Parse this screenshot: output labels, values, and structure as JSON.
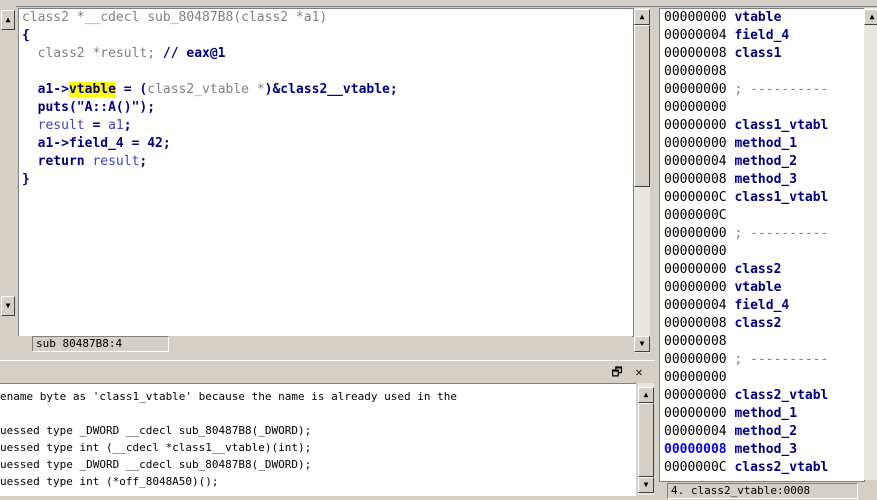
{
  "code_view": {
    "signature": "class2 *__cdecl sub_80487B8(class2 *a1)",
    "open_brace": "{",
    "decl_type": "class2 *result; ",
    "decl_comment": "// eax@1",
    "l1_a": "a1->",
    "l1_field": "vtable",
    "l1_b": " = (",
    "l1_cast": "class2_vtable *",
    "l1_c": ")&class2__vtable;",
    "l2": "puts(\"A::A()\");",
    "l3_a": "result",
    "l3_b": " = ",
    "l3_c": "a1",
    "l3_d": ";",
    "l4": "a1->field_4 = 42;",
    "l5_a": "return ",
    "l5_b": "result",
    "l5_c": ";",
    "close_brace": "}"
  },
  "code_status": "sub 80487B8:4",
  "output_window": {
    "lines": [
      "ename byte as 'class1_vtable' because the name is already used in the",
      "",
      "uessed type _DWORD __cdecl sub_80487B8(_DWORD);",
      "uessed type int (__cdecl *class1__vtable)(int);",
      "uessed type _DWORD __cdecl sub_80487B8(_DWORD);",
      "uessed type int (*off_8048A50)();"
    ],
    "dock_icon": "🗗",
    "close_icon": "✕"
  },
  "structures": {
    "rows": [
      {
        "addr": "00000000",
        "name": "vtable",
        "kind": "member"
      },
      {
        "addr": "00000004",
        "name": "field_4",
        "kind": "member"
      },
      {
        "addr": "00000008",
        "name": "class1",
        "kind": "member"
      },
      {
        "addr": "00000008",
        "name": "",
        "kind": "blank"
      },
      {
        "addr": "00000000",
        "name": "; ----------",
        "kind": "sep"
      },
      {
        "addr": "00000000",
        "name": "",
        "kind": "blank"
      },
      {
        "addr": "00000000",
        "name": "class1_vtabl",
        "kind": "member"
      },
      {
        "addr": "00000000",
        "name": "method_1",
        "kind": "member"
      },
      {
        "addr": "00000004",
        "name": "method_2",
        "kind": "member"
      },
      {
        "addr": "00000008",
        "name": "method_3",
        "kind": "member"
      },
      {
        "addr": "0000000C",
        "name": "class1_vtabl",
        "kind": "member"
      },
      {
        "addr": "0000000C",
        "name": "",
        "kind": "blank"
      },
      {
        "addr": "00000000",
        "name": "; ----------",
        "kind": "sep"
      },
      {
        "addr": "00000000",
        "name": "",
        "kind": "blank"
      },
      {
        "addr": "00000000",
        "name": "class2",
        "kind": "member"
      },
      {
        "addr": "00000000",
        "name": "vtable",
        "kind": "member"
      },
      {
        "addr": "00000004",
        "name": "field_4",
        "kind": "member"
      },
      {
        "addr": "00000008",
        "name": "class2",
        "kind": "member"
      },
      {
        "addr": "00000008",
        "name": "",
        "kind": "blank"
      },
      {
        "addr": "00000000",
        "name": "; ----------",
        "kind": "sep"
      },
      {
        "addr": "00000000",
        "name": "",
        "kind": "blank"
      },
      {
        "addr": "00000000",
        "name": "class2_vtabl",
        "kind": "member"
      },
      {
        "addr": "00000000",
        "name": "method_1",
        "kind": "member"
      },
      {
        "addr": "00000004",
        "name": "method_2",
        "kind": "member"
      },
      {
        "addr": "00000008",
        "name": "method_3",
        "kind": "selected"
      },
      {
        "addr": "0000000C",
        "name": "class2_vtabl",
        "kind": "member"
      }
    ],
    "status": "4. class2_vtable:0008"
  },
  "colors": {
    "highlight": "#ffff00",
    "code_blue": "#1e1e9e",
    "selected_addr": "#0000ff"
  },
  "icons": {
    "up": "▲",
    "down": "▼",
    "left": "◄"
  }
}
